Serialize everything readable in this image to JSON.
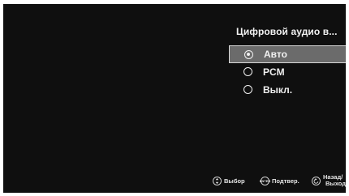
{
  "menu": {
    "title": "Цифровой аудио в...",
    "options": [
      {
        "label": "Авто",
        "selected": true
      },
      {
        "label": "PCM",
        "selected": false
      },
      {
        "label": "Выкл.",
        "selected": false
      }
    ]
  },
  "footer": {
    "select_label": "Выбор",
    "confirm_label": "Подтвер.",
    "enter_icon_text": "ENTER",
    "back_label_line1": "Назад/",
    "back_label_line2": "Выход"
  }
}
